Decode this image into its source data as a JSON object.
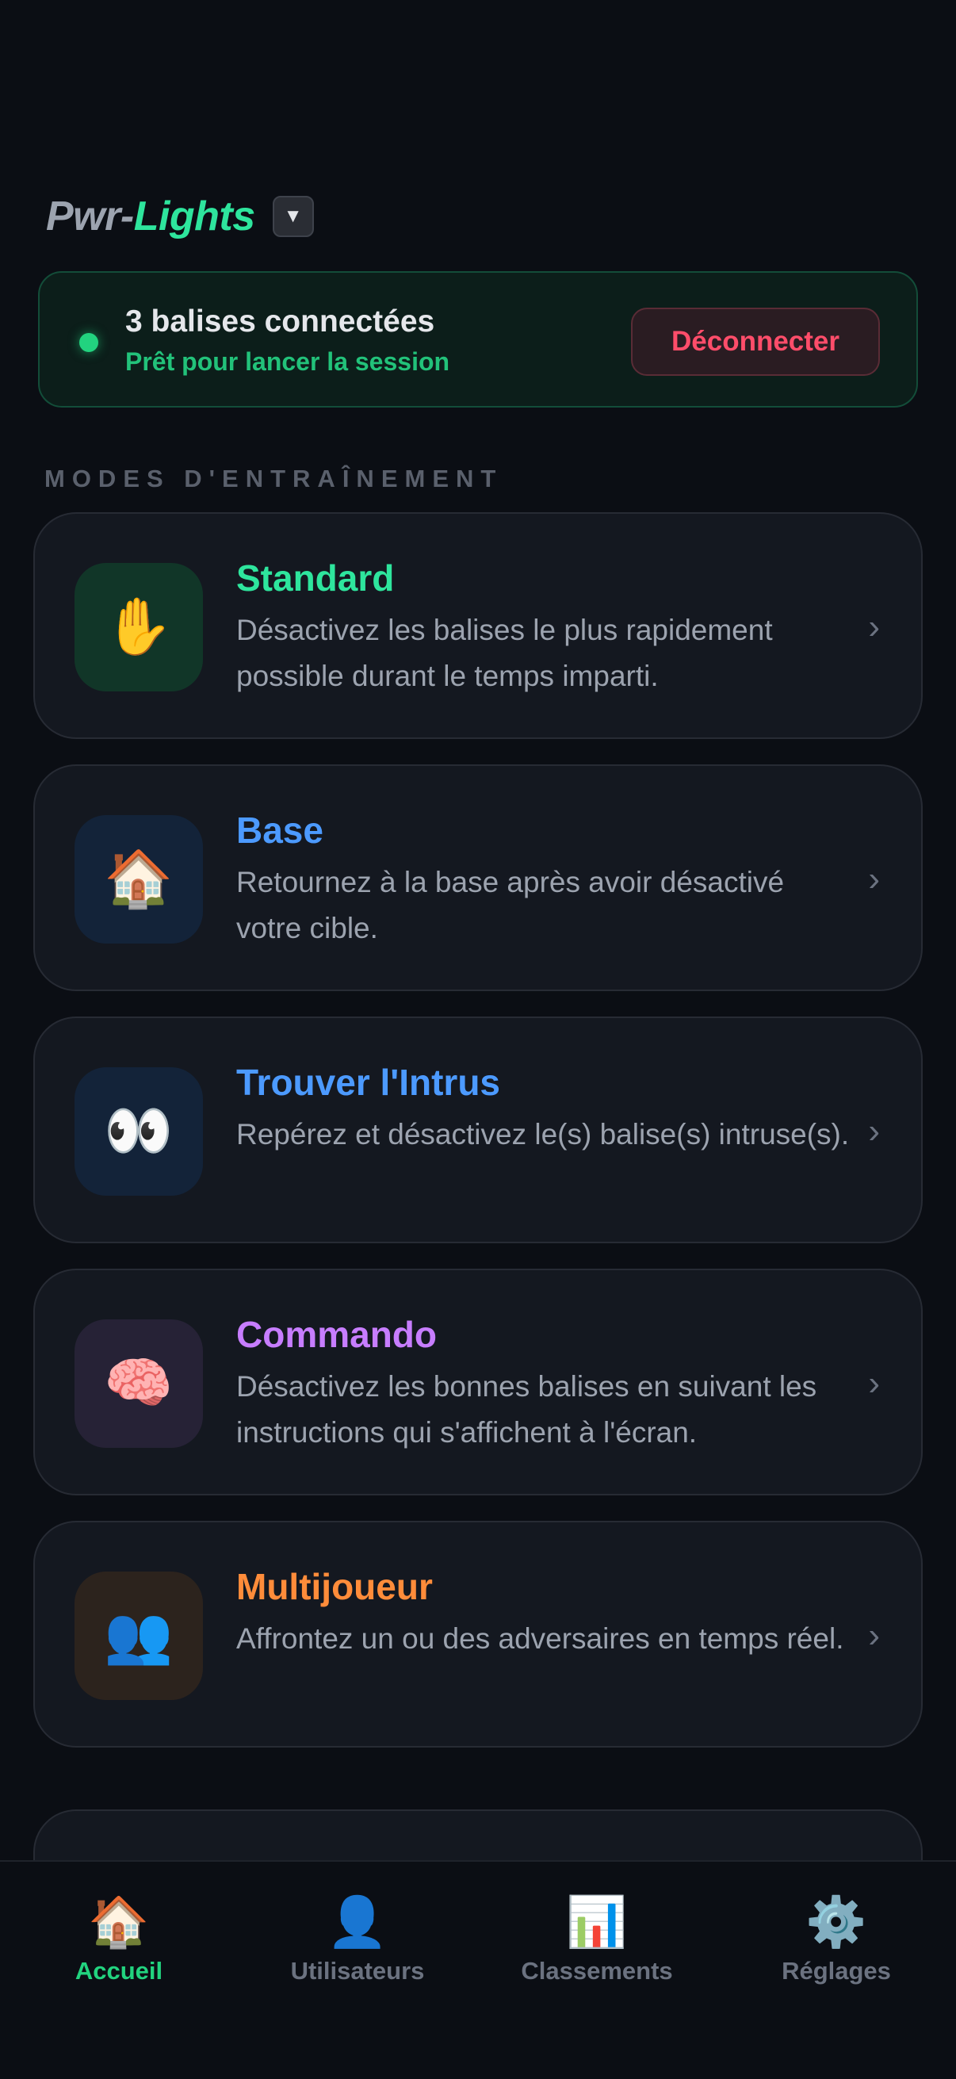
{
  "app": {
    "logo_part1": "Pwr-",
    "logo_part2": "Lights",
    "dropdown_glyph": "▼"
  },
  "status": {
    "title": "3 balises connectées",
    "subtitle": "Prêt pour lancer la session",
    "disconnect_label": "Déconnecter",
    "indicator_color": "#22d37f"
  },
  "modes_section": {
    "label": "MODES D'ENTRAÎNEMENT",
    "items": [
      {
        "title": "Standard",
        "description": "Désactivez les balises le plus rapidement possible durant le temps imparti.",
        "icon": "✋",
        "icon_name": "raised-hand-icon",
        "title_color": "#2ee59d",
        "icon_bg": "#113628"
      },
      {
        "title": "Base",
        "description": "Retournez à la base après avoir désactivé votre cible.",
        "icon": "🏠",
        "icon_name": "house-icon",
        "title_color": "#4c9aff",
        "icon_bg": "#132339"
      },
      {
        "title": "Trouver l'Intrus",
        "description": "Repérez et désactivez le(s) balise(s) intruse(s).",
        "icon": "👀",
        "icon_name": "eyes-icon",
        "title_color": "#4c9aff",
        "icon_bg": "#132339"
      },
      {
        "title": "Commando",
        "description": "Désactivez les bonnes balises en suivant les instructions qui s'affichent à l'écran.",
        "icon": "🧠",
        "icon_name": "brain-icon",
        "title_color": "#c77dff",
        "icon_bg": "#262236"
      },
      {
        "title": "Multijoueur",
        "description": "Affrontez un ou des adversaires en temps réel.",
        "icon": "👥",
        "icon_name": "people-icon",
        "title_color": "#ff8c3a",
        "icon_bg": "#2c231d"
      }
    ],
    "chevron": "›"
  },
  "bottom_nav": {
    "items": [
      {
        "label": "Accueil",
        "icon": "🏠",
        "icon_name": "home-icon",
        "active": true
      },
      {
        "label": "Utilisateurs",
        "icon": "👤",
        "icon_name": "user-icon",
        "active": false
      },
      {
        "label": "Classements",
        "icon": "📊",
        "icon_name": "chart-icon",
        "active": false
      },
      {
        "label": "Réglages",
        "icon": "⚙️",
        "icon_name": "gear-icon",
        "active": false
      }
    ],
    "active_color": "#22d37f"
  }
}
